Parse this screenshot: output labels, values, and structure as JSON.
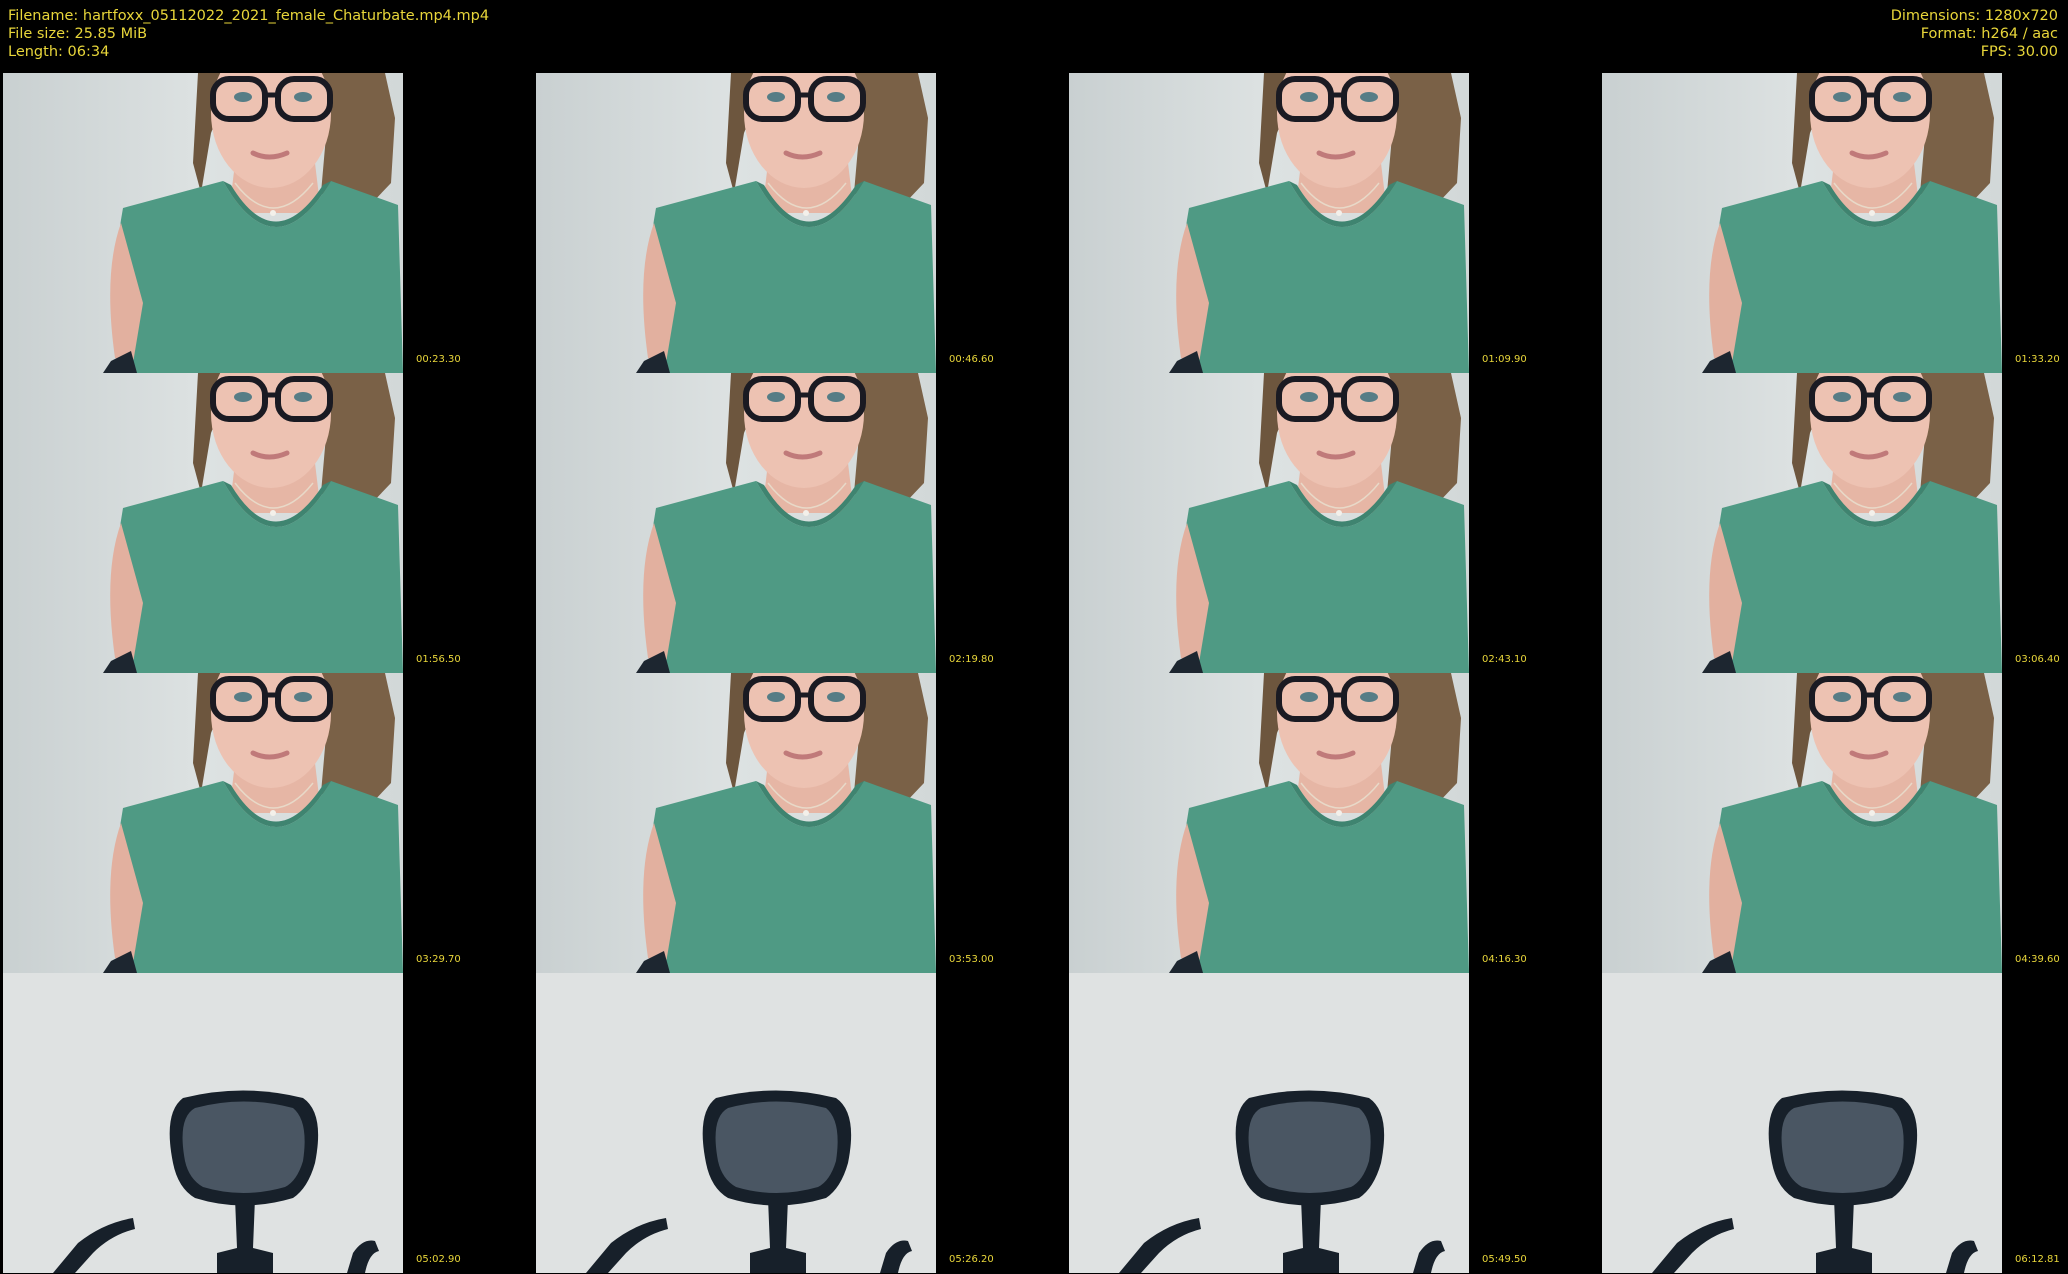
{
  "header": {
    "filename": "Filename: hartfoxx_05112022_2021_female_Chaturbate.mp4.mp4",
    "file_size": "File size: 25.85 MiB",
    "length": "Length: 06:34",
    "dimensions": "Dimensions: 1280x720",
    "format": "Format: h264 / aac",
    "fps": "FPS: 30.00"
  },
  "colors": {
    "text": "#e8d63a",
    "background": "#000000",
    "shirt": "#4f9a84",
    "wall": "#d7dcdc"
  },
  "thumbnails": [
    {
      "time": "00:23.30",
      "scene": "person"
    },
    {
      "time": "00:46.60",
      "scene": "person"
    },
    {
      "time": "01:09.90",
      "scene": "person"
    },
    {
      "time": "01:33.20",
      "scene": "person"
    },
    {
      "time": "01:56.50",
      "scene": "person"
    },
    {
      "time": "02:19.80",
      "scene": "person"
    },
    {
      "time": "02:43.10",
      "scene": "person"
    },
    {
      "time": "03:06.40",
      "scene": "person"
    },
    {
      "time": "03:29.70",
      "scene": "person"
    },
    {
      "time": "03:53.00",
      "scene": "person"
    },
    {
      "time": "04:16.30",
      "scene": "person"
    },
    {
      "time": "04:39.60",
      "scene": "person"
    },
    {
      "time": "05:02.90",
      "scene": "chair"
    },
    {
      "time": "05:26.20",
      "scene": "chair"
    },
    {
      "time": "05:49.50",
      "scene": "chair"
    },
    {
      "time": "06:12.81",
      "scene": "chair"
    }
  ]
}
